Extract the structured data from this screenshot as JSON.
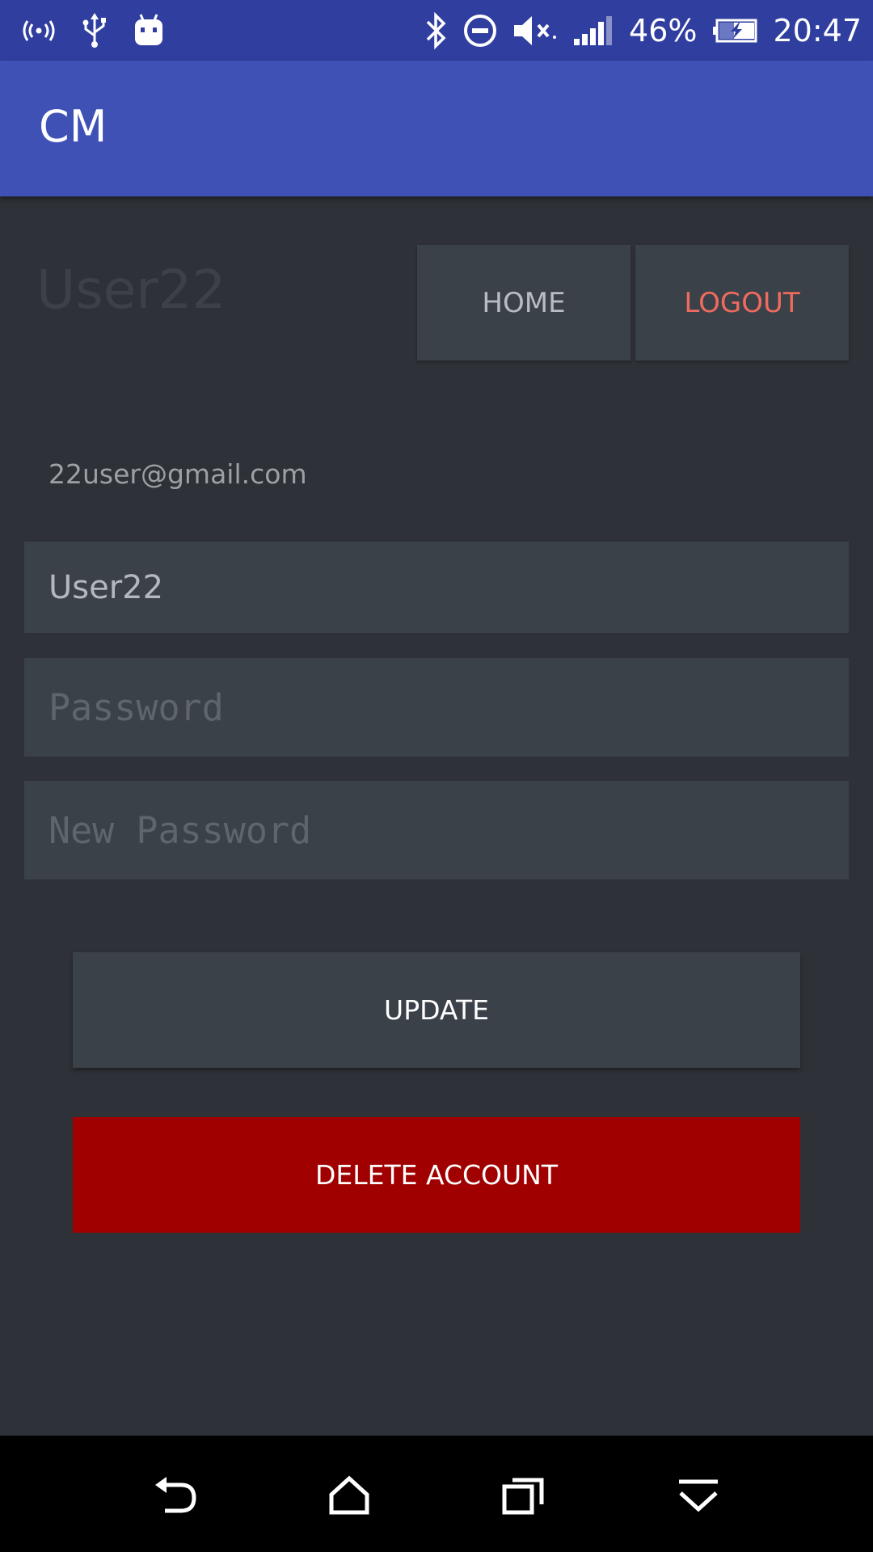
{
  "status_bar": {
    "battery_percent": "46%",
    "time": "20:47",
    "left_icons": [
      "hotspot-icon",
      "usb-icon",
      "android-icon"
    ],
    "right_icons": [
      "bluetooth-icon",
      "do-not-disturb-icon",
      "volume-muted-icon",
      "signal-icon",
      "battery-charging-icon"
    ]
  },
  "app_bar": {
    "title": "CM",
    "color": "#3f51b5"
  },
  "profile": {
    "username_display": "User22",
    "email": "22user@gmail.com"
  },
  "top_buttons": {
    "home_label": "HOME",
    "logout_label": "LOGOUT",
    "logout_color": "#ef6b5e"
  },
  "form": {
    "username_value": "User22",
    "password_placeholder": "Password",
    "new_password_placeholder": "New Password"
  },
  "actions": {
    "update_label": "UPDATE",
    "delete_label": "DELETE ACCOUNT",
    "delete_color": "#a00000"
  },
  "nav_bar": {
    "icons": [
      "back-icon",
      "home-icon",
      "recents-icon",
      "collapse-icon"
    ]
  }
}
